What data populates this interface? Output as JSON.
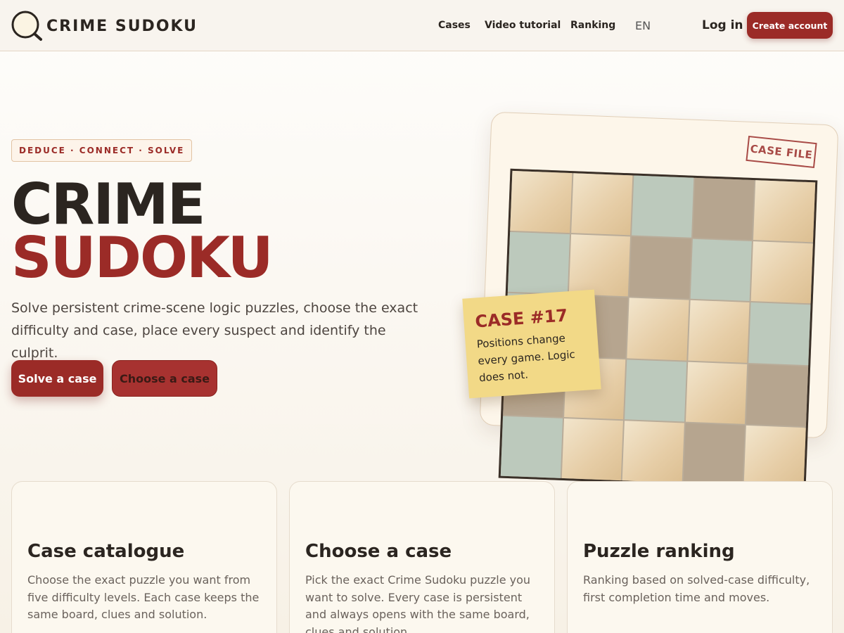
{
  "header": {
    "logo_text": "CRIME SUDOKU",
    "nav": [
      {
        "label": "Cases"
      },
      {
        "label": "Video tutorial"
      },
      {
        "label": "Ranking"
      }
    ],
    "language": "EN",
    "login": "Log in",
    "create_account": "Create account"
  },
  "hero": {
    "tagline": "DEDUCE · CONNECT · SOLVE",
    "title_line1": "CRIME",
    "title_line2": "SUDOKU",
    "intro": "Solve persistent crime-scene logic puzzles, choose the exact difficulty and case, place every suspect and identify the culprit.",
    "primary_button": "Solve a case",
    "secondary_button": "Choose a case"
  },
  "case_file": {
    "stamp": "CASE FILE",
    "board_cells": [
      "sand",
      "sand",
      "sage",
      "stone",
      "sand",
      "sage",
      "sand",
      "stone",
      "sage",
      "sand",
      "sage",
      "stone",
      "sand",
      "sand",
      "sage",
      "stone",
      "sand",
      "sage",
      "sand",
      "stone",
      "sage",
      "sand",
      "sand",
      "stone",
      "sand"
    ],
    "note_title": "CASE #17",
    "note_text": "Positions change every game. Logic does not."
  },
  "features": [
    {
      "title": "Case catalogue",
      "text": "Choose the exact puzzle you want from five difficulty levels. Each case keeps the same board, clues and solution."
    },
    {
      "title": "Choose a case",
      "text": "Pick the exact Crime Sudoku puzzle you want to solve. Every case is persistent and always opens with the same board, clues and solution."
    },
    {
      "title": "Puzzle ranking",
      "text": "Ranking based on solved-case difficulty, first completion time and moves."
    }
  ],
  "colors": {
    "accent": "#9b2b27",
    "text": "#2b2520",
    "cell_sand": "#e6cda6",
    "cell_sage": "#bcc9bc",
    "cell_stone": "#b6a58f",
    "note": "#f2d987"
  }
}
